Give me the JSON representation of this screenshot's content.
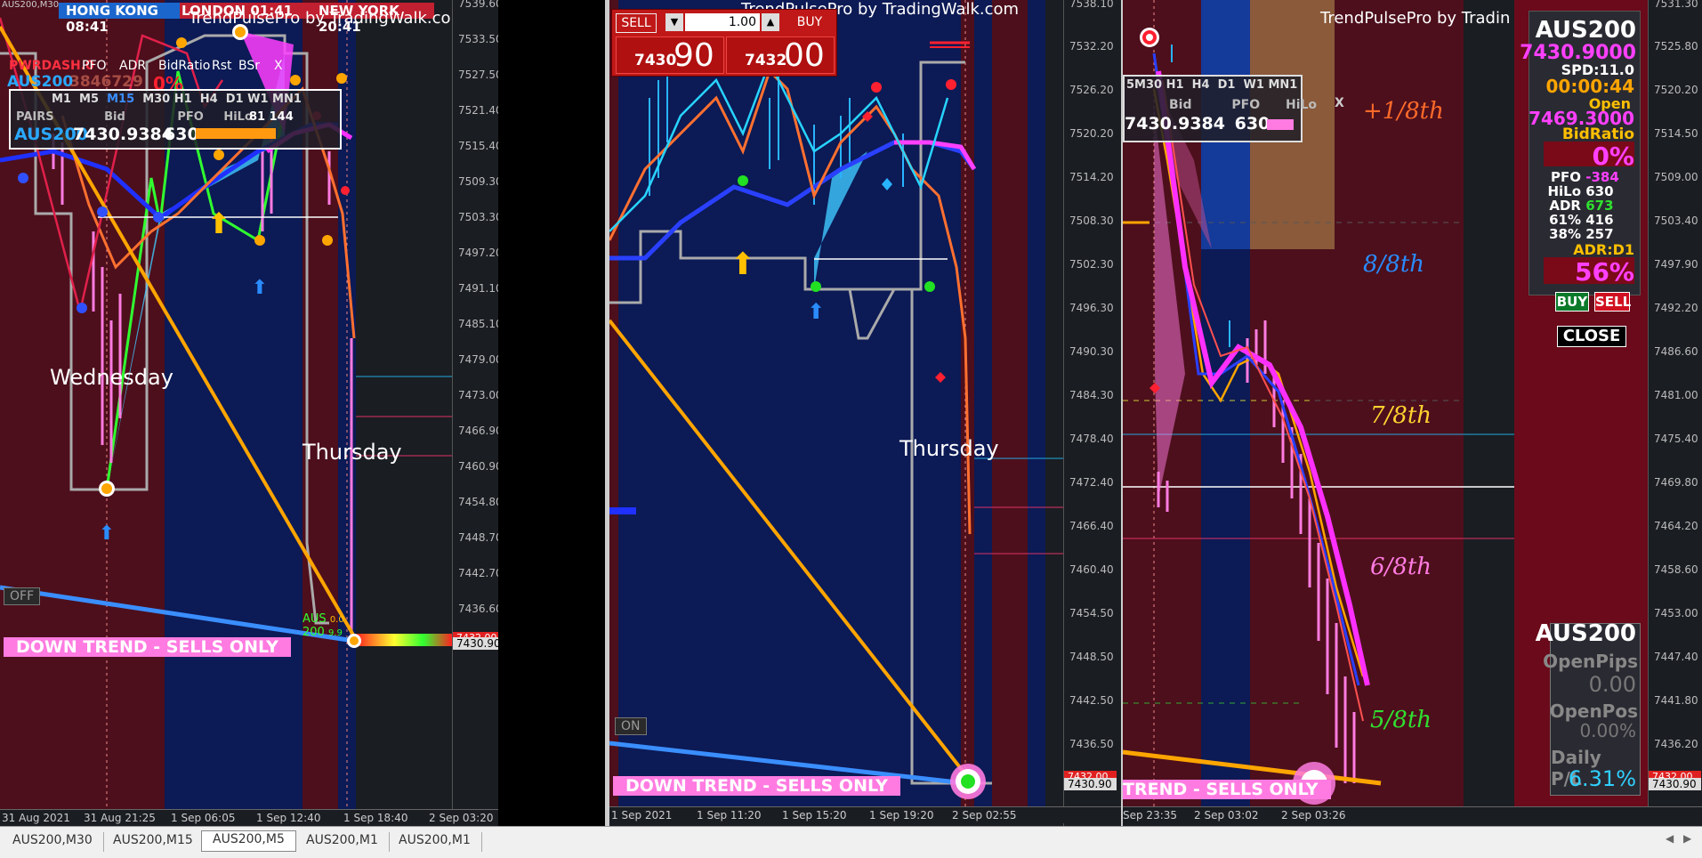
{
  "pane1": {
    "symbol_title": "AUS200,M30",
    "sessions": {
      "hk": "HONG KONG",
      "hk_time": "08:41",
      "london": "LONDON",
      "london_time": "01:41",
      "ny": "NEW YORK",
      "ny_time": "20:41"
    },
    "watermark": "TrendPulsePro by TradingWalk.com",
    "dash": {
      "title": "PWRDASH.0",
      "sym": "AUS200",
      "tabs": [
        "PFO",
        "ADR",
        "BidRatio",
        "Rst",
        "BSr",
        "X"
      ],
      "tf": [
        "M1",
        "M5",
        "M15",
        "M30",
        "H1",
        "H4",
        "D1",
        "W1",
        "MN1"
      ],
      "cols": [
        "PAIRS",
        "Bid",
        "PFO",
        "HiLo"
      ],
      "row_sym": "AUS200",
      "row_bid": "7430.9384",
      "row_pfo": "630",
      "row_hilo": "81 144",
      "pct": "0%",
      "dim": "3846729"
    },
    "day_labels": [
      "Wednesday",
      "Thursday"
    ],
    "banner": "DOWN TREND - SELLS ONLY",
    "toggle": "OFF",
    "yticks": [
      "7539.60",
      "7533.50",
      "7527.50",
      "7521.40",
      "7515.40",
      "7509.30",
      "7503.30",
      "7497.20",
      "7491.10",
      "7485.10",
      "7479.00",
      "7473.00",
      "7466.90",
      "7460.90",
      "7454.80",
      "7448.70",
      "7442.70",
      "7436.60",
      "7430.90"
    ],
    "price_tag": "7430.90",
    "price_tag_hi": "7432.00",
    "xticks": [
      "31 Aug 2021",
      "31 Aug 21:25",
      "1 Sep 06:05",
      "1 Sep 12:40",
      "1 Sep 18:40",
      "2 Sep 03:20"
    ],
    "mini": {
      "aus": "AUS",
      "n": "200",
      "v1": "0.0",
      "v2": "9.9"
    }
  },
  "pane2": {
    "watermark": "TrendPulsePro by TradingWalk.com",
    "trade": {
      "sell": "SELL",
      "buy": "BUY",
      "lot": "1.00",
      "sell_small": "7430",
      "sell_big": "90",
      "buy_small": "7432",
      "buy_big": "00"
    },
    "day_label": "Thursday",
    "banner": "DOWN TREND - SELLS ONLY",
    "toggle": "ON",
    "yticks": [
      "7538.10",
      "7532.20",
      "7526.20",
      "7520.20",
      "7514.20",
      "7508.30",
      "7502.30",
      "7496.30",
      "7490.30",
      "7484.30",
      "7478.40",
      "7472.40",
      "7466.40",
      "7460.40",
      "7454.50",
      "7448.50",
      "7442.50",
      "7436.50",
      "7430.90"
    ],
    "price_tag": "7430.90",
    "price_tag_hi": "7432.00",
    "xticks": [
      "1 Sep 2021",
      "1 Sep 11:20",
      "1 Sep 15:20",
      "1 Sep 19:20",
      "2 Sep 02:55"
    ]
  },
  "pane3": {
    "watermark": "TrendPulsePro by Tradin",
    "dash": {
      "tf": [
        "5",
        "M30",
        "H1",
        "H4",
        "D1",
        "W1",
        "MN1"
      ],
      "cols": [
        "Bid",
        "PFO",
        "HiLo",
        "X"
      ],
      "bid": "7430.9384",
      "pfo": "630"
    },
    "fractions": [
      "+1/8th",
      "8/8th",
      "7/8th",
      "6/8th",
      "5/8th"
    ],
    "banner": "TREND - SELLS ONLY",
    "yticks": [
      "7531.30",
      "7525.80",
      "7520.20",
      "7514.50",
      "7509.00",
      "7503.40",
      "7497.90",
      "7492.20",
      "7486.60",
      "7481.00",
      "7475.40",
      "7469.80",
      "7464.20",
      "7458.60",
      "7453.00",
      "7447.40",
      "7441.80",
      "7436.20",
      "7430.90"
    ],
    "price_tag": "7430.90",
    "price_tag_hi": "7432.00",
    "xticks": [
      "Sep 23:35",
      "2 Sep 03:02",
      "2 Sep 03:26"
    ]
  },
  "info": {
    "symbol": "AUS200",
    "price": "7430.9000",
    "spread": "SPD:11.0",
    "timer": "00:00:44",
    "open_label": "Open",
    "open_price": "7469.3000",
    "bidratio_label": "BidRatio",
    "bidratio": "0%",
    "rows": [
      [
        "PFO",
        "-384"
      ],
      [
        "HiLo",
        "630"
      ],
      [
        "ADR",
        "673"
      ],
      [
        "61%",
        "416"
      ],
      [
        "38%",
        "257"
      ]
    ],
    "adr_label": "ADR:D1",
    "adr_pct": "56%",
    "buy": "BUY",
    "sell": "SELL",
    "close": "CLOSE"
  },
  "pl": {
    "symbol": "AUS200",
    "open_pips_label": "OpenPips",
    "open_pips": "0.00",
    "open_pos_label": "OpenPos",
    "open_pos": "0.00%",
    "daily_label": "Daily P/L",
    "daily": "6.31%"
  },
  "tabs": [
    "AUS200,M30",
    "AUS200,M15",
    "AUS200,M5",
    "AUS200,M1",
    "AUS200,M1"
  ],
  "colors": {
    "maroon": "#5a1020",
    "navy": "#0c1a55",
    "pink": "#ff7be1",
    "orange": "#ffa500",
    "blue": "#2040ff",
    "cyan": "#28b4ff",
    "magenta": "#ff40ff",
    "red": "#ff2030"
  }
}
